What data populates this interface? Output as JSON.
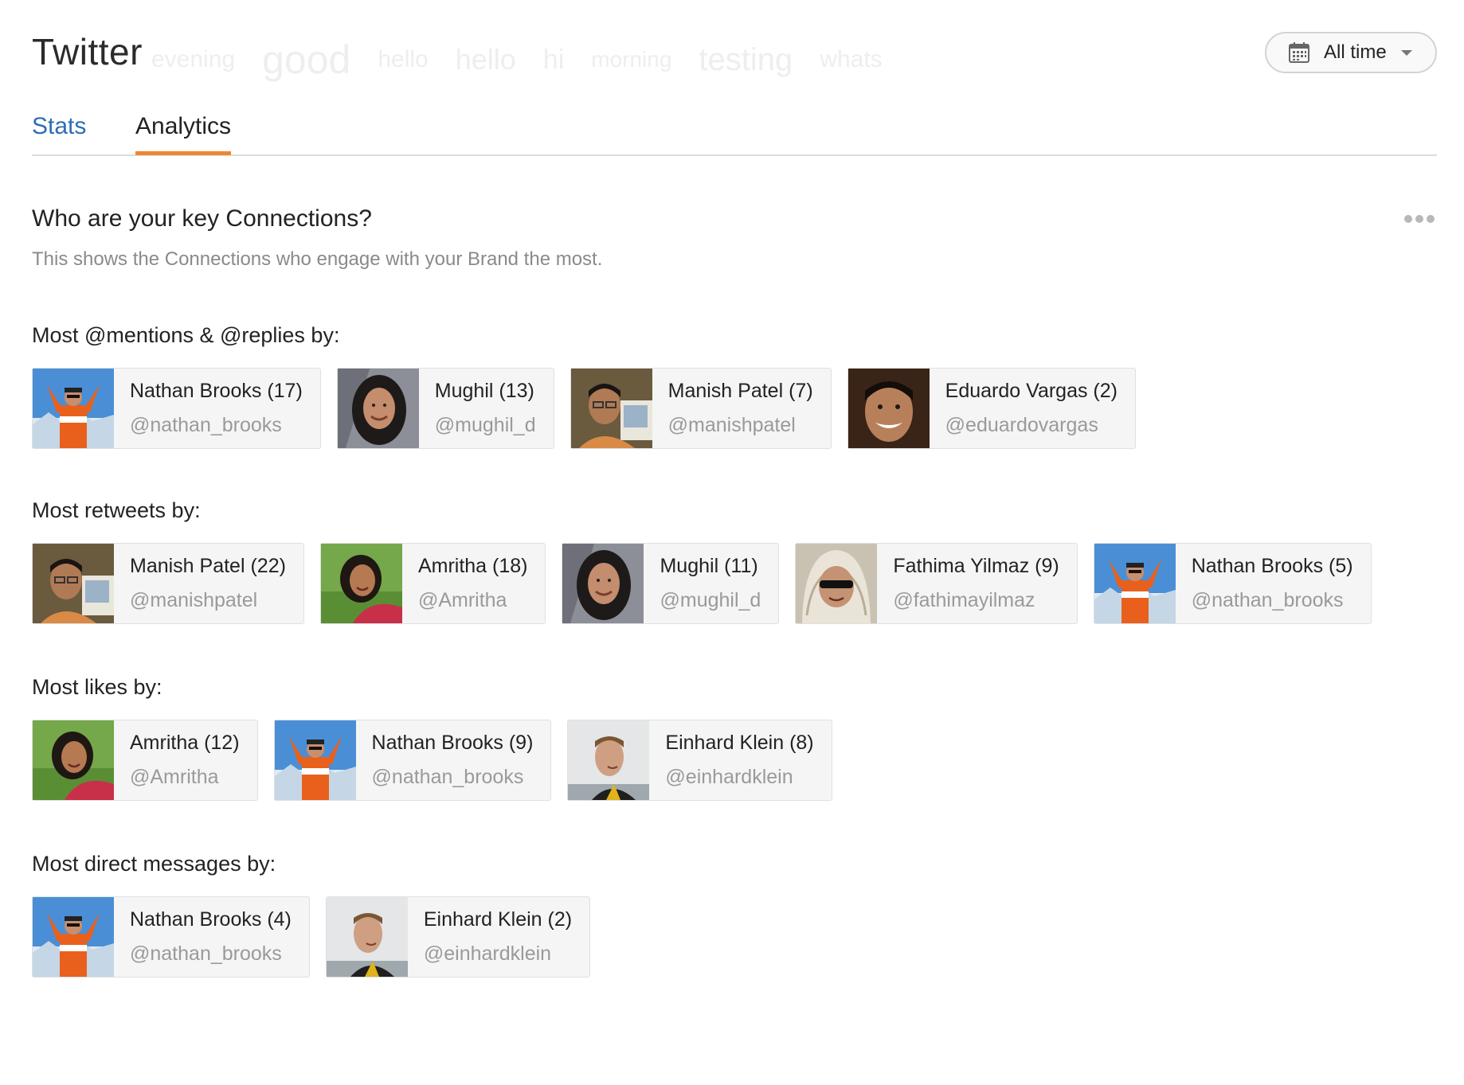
{
  "header": {
    "title": "Twitter",
    "word_cloud": [
      "evening",
      "good",
      "hello",
      "hello",
      "hi",
      "morning",
      "testing",
      "whats"
    ],
    "time_filter": {
      "label": "All time",
      "icon": "calendar-icon"
    }
  },
  "tabs": [
    {
      "label": "Stats",
      "active": false
    },
    {
      "label": "Analytics",
      "active": true
    }
  ],
  "section": {
    "title": "Who are your key Connections?",
    "subtitle": "This shows the Connections who engage with your Brand the most.",
    "more_icon": "more-dots-icon"
  },
  "colors": {
    "accent": "#f08632",
    "link": "#2f6db5"
  },
  "groups": [
    {
      "title": "Most @mentions & @replies by:",
      "items": [
        {
          "name": "Nathan Brooks (17)",
          "handle": "@nathan_brooks",
          "avatar": "nathan"
        },
        {
          "name": "Mughil (13)",
          "handle": "@mughil_d",
          "avatar": "mughil"
        },
        {
          "name": "Manish Patel (7)",
          "handle": "@manishpatel",
          "avatar": "manish"
        },
        {
          "name": "Eduardo Vargas (2)",
          "handle": "@eduardovargas",
          "avatar": "eduardo"
        }
      ]
    },
    {
      "title": "Most retweets by:",
      "items": [
        {
          "name": "Manish Patel (22)",
          "handle": "@manishpatel",
          "avatar": "manish"
        },
        {
          "name": "Amritha (18)",
          "handle": "@Amritha",
          "avatar": "amritha"
        },
        {
          "name": "Mughil (11)",
          "handle": "@mughil_d",
          "avatar": "mughil"
        },
        {
          "name": "Fathima Yilmaz (9)",
          "handle": "@fathimayilmaz",
          "avatar": "fathima"
        },
        {
          "name": "Nathan Brooks (5)",
          "handle": "@nathan_brooks",
          "avatar": "nathan"
        }
      ]
    },
    {
      "title": "Most likes by:",
      "items": [
        {
          "name": "Amritha (12)",
          "handle": "@Amritha",
          "avatar": "amritha"
        },
        {
          "name": "Nathan Brooks (9)",
          "handle": "@nathan_brooks",
          "avatar": "nathan"
        },
        {
          "name": "Einhard Klein (8)",
          "handle": "@einhardklein",
          "avatar": "einhard"
        }
      ]
    },
    {
      "title": "Most direct messages by:",
      "items": [
        {
          "name": "Nathan Brooks (4)",
          "handle": "@nathan_brooks",
          "avatar": "nathan"
        },
        {
          "name": "Einhard Klein (2)",
          "handle": "@einhardklein",
          "avatar": "einhard"
        }
      ]
    }
  ]
}
